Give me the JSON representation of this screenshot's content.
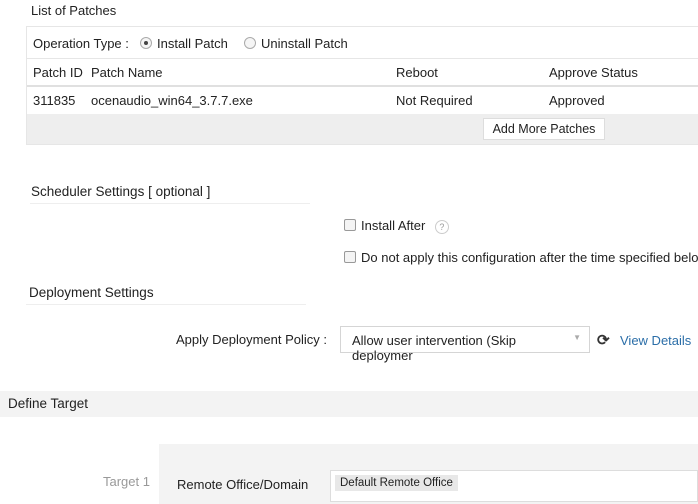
{
  "patches": {
    "title": "List of Patches",
    "operation_label": "Operation Type :",
    "op_install": "Install Patch",
    "op_uninstall": "Uninstall Patch",
    "columns": [
      "Patch ID",
      "Patch Name",
      "Reboot",
      "Approve Status"
    ],
    "rows": [
      {
        "id": "311835",
        "name": "ocenaudio_win64_3.7.7.exe",
        "reboot": "Not Required",
        "status": "Approved"
      }
    ],
    "add_more": "Add More Patches"
  },
  "scheduler": {
    "title": "Scheduler Settings [ optional ]",
    "install_after": "Install After",
    "help": "?",
    "do_not_apply": "Do not apply this configuration after the time specified below"
  },
  "deployment": {
    "title": "Deployment Settings",
    "policy_label": "Apply Deployment Policy :",
    "policy_value": "Allow user intervention (Skip deploymer",
    "view_details": "View Details"
  },
  "target": {
    "title": "Define Target",
    "target_label": "Target 1",
    "field_label": "Remote Office/Domain",
    "value": "Default Remote Office"
  }
}
